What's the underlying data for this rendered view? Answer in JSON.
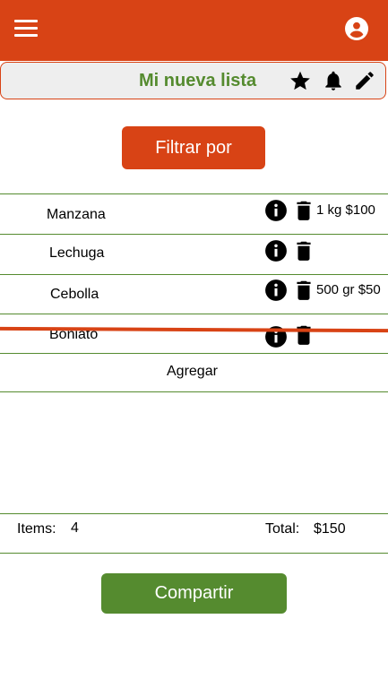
{
  "header": {
    "menu_icon": "menu-icon",
    "account_icon": "account-circle-icon",
    "color": "#d84315"
  },
  "list": {
    "title": "Mi nueva lista",
    "title_color": "#558b2f",
    "actions": [
      "star-icon",
      "bell-icon",
      "pencil-icon"
    ]
  },
  "filter": {
    "label": "Filtrar por"
  },
  "items": [
    {
      "name": "Manzana",
      "detail": "1 kg $100",
      "crossed": false
    },
    {
      "name": "Lechuga",
      "detail": "",
      "crossed": false
    },
    {
      "name": "Cebolla",
      "detail": "500 gr $50",
      "crossed": false
    },
    {
      "name": "Boniato",
      "detail": "",
      "crossed": true
    }
  ],
  "add_label": "Agregar",
  "summary": {
    "items_label": "Items:",
    "items_count": "4",
    "total_label": "Total:",
    "total_value": "$150"
  },
  "share": {
    "label": "Compartir",
    "color": "#558b2f"
  }
}
